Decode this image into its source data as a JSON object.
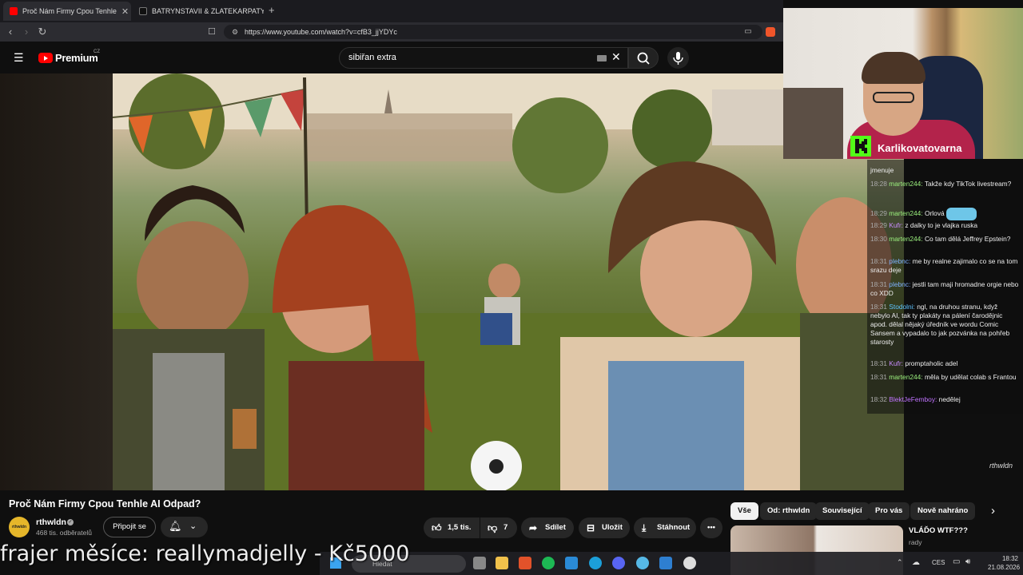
{
  "browser": {
    "tabs": [
      {
        "title": "Proč Nám Firmy Cpou Tenhle",
        "active": true
      },
      {
        "title": "BATRYNSTAVII & ZLATEKARPATY (@",
        "active": false
      }
    ],
    "url": "https://www.youtube.com/watch?v=cfB3_jjYDYc"
  },
  "youtube": {
    "logo": "Premium",
    "region": "CZ",
    "search_value": "sibiřan extra",
    "video_title": "Proč Nám Firmy Cpou Tenhle AI Odpad?",
    "channel": {
      "name": "rthwldn",
      "subscribers": "468 tis. odběratelů",
      "avatar_text": "rthwldn"
    },
    "join_label": "Připojit se",
    "likes": "1,5 tis.",
    "dislikes": "7",
    "share_label": "Sdílet",
    "save_label": "Uložit",
    "download_label": "Stáhnout",
    "watermark": "rthwldn",
    "chips": [
      "Vše",
      "Od: rthwldn",
      "Související",
      "Pro vás",
      "Nově nahráno"
    ],
    "recommended": {
      "title": "VLÁĎO WTF???",
      "channel": "rady"
    }
  },
  "webcam": {
    "streamer": "Karlikovatovarna"
  },
  "chat": [
    {
      "time": "",
      "user": "",
      "msg": "jmenuje",
      "color": "#ffffff"
    },
    {
      "time": "18:28",
      "user": "marten244:",
      "msg": "Takže kdy TikTok livestream?",
      "color": "#9cf27e"
    },
    {
      "time": "18:29",
      "user": "marten244:",
      "msg": "Orlová",
      "color": "#9cf27e"
    },
    {
      "time": "18:29",
      "user": "Kufr:",
      "msg": "z dalky to je vlajka ruska",
      "color": "#c98cff"
    },
    {
      "time": "18:30",
      "user": "marten244:",
      "msg": "Co tam dělá Jeffrey Epstein?",
      "color": "#9cf27e"
    },
    {
      "time": "18:31",
      "user": "plebnc:",
      "msg": "me by realne zajimalo co se na tom srazu deje",
      "color": "#7fb2ff"
    },
    {
      "time": "18:31",
      "user": "plebnc:",
      "msg": "jestli tam maji hromadne orgie nebo co XDD",
      "color": "#7fb2ff"
    },
    {
      "time": "18:31",
      "user": "Stodolni:",
      "msg": "ngl, na druhou stranu, když nebylo AI, tak ty plakáty na pálení čarodějnic apod. dělal nějaký úředník ve wordu Comic Sansem a vypadalo to jak pozvánka na pohřeb starosty",
      "color": "#5ec4ff"
    },
    {
      "time": "18:31",
      "user": "Kufr:",
      "msg": "promptaholic adel",
      "color": "#c98cff"
    },
    {
      "time": "18:31",
      "user": "marten244:",
      "msg": "měla by udělat colab s Frantou",
      "color": "#9cf27e"
    },
    {
      "time": "18:32",
      "user": "BlektJeFemboy:",
      "msg": "nedělej",
      "color": "#c073ff"
    }
  ],
  "overlay_text": "frajer měsíce: reallymadjelly - Kč5000",
  "taskbar": {
    "search_placeholder": "Hledat",
    "language": "CES",
    "time": "18:32",
    "date": "21.08.2026"
  }
}
